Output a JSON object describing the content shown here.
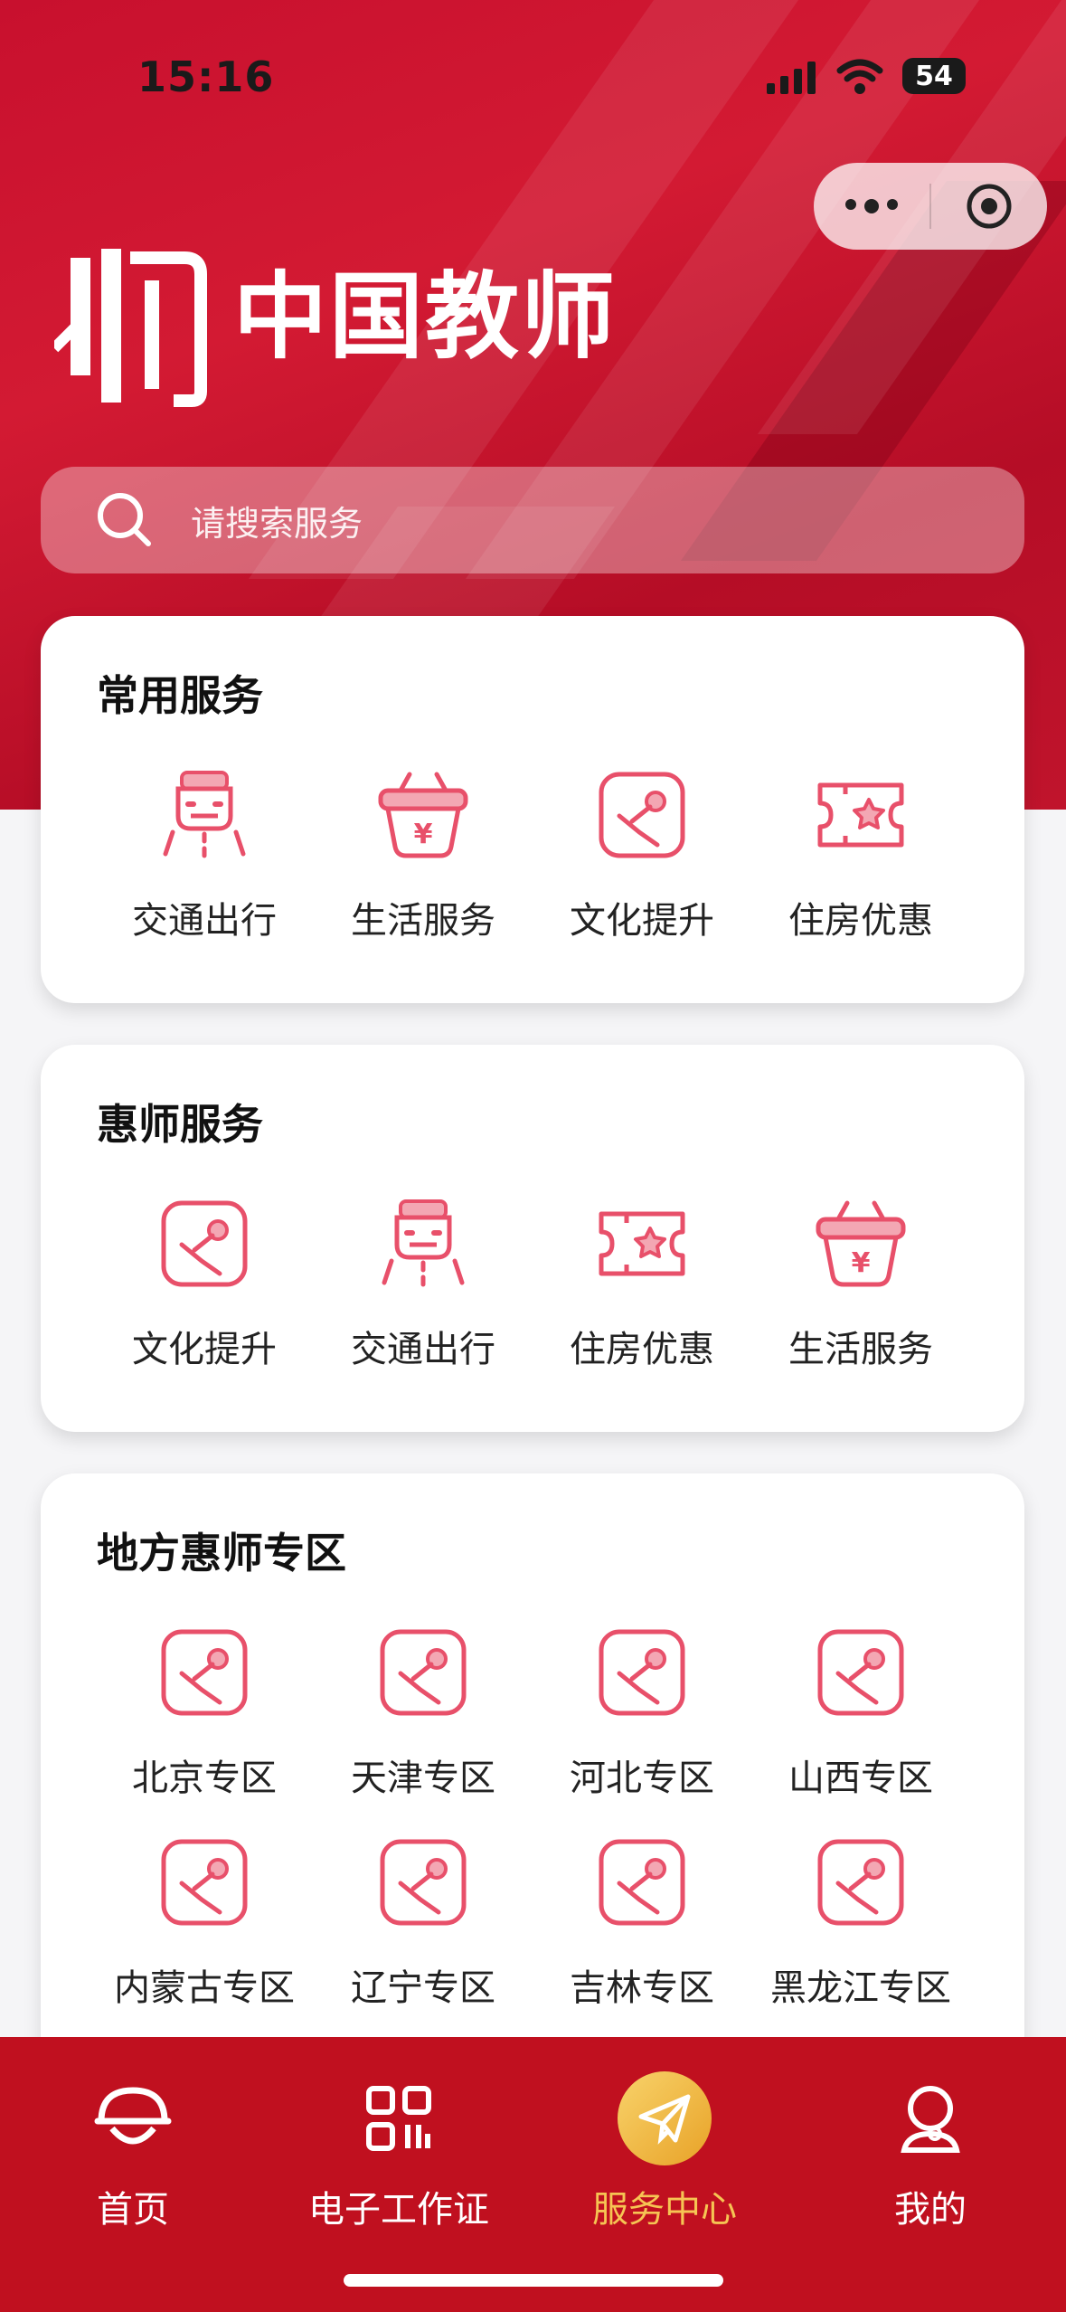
{
  "status_bar": {
    "time": "15:16",
    "battery": "54"
  },
  "app": {
    "brand": "中国教师"
  },
  "search": {
    "placeholder": "请搜索服务"
  },
  "sections": [
    {
      "title": "常用服务",
      "items": [
        {
          "label": "交通出行",
          "icon": "transport-icon"
        },
        {
          "label": "生活服务",
          "icon": "basket-icon"
        },
        {
          "label": "文化提升",
          "icon": "culture-icon"
        },
        {
          "label": "住房优惠",
          "icon": "ticket-icon"
        }
      ]
    },
    {
      "title": "惠师服务",
      "items": [
        {
          "label": "文化提升",
          "icon": "culture-icon"
        },
        {
          "label": "交通出行",
          "icon": "transport-icon"
        },
        {
          "label": "住房优惠",
          "icon": "ticket-icon"
        },
        {
          "label": "生活服务",
          "icon": "basket-icon"
        }
      ]
    },
    {
      "title": "地方惠师专区",
      "items": [
        {
          "label": "北京专区",
          "icon": "culture-icon"
        },
        {
          "label": "天津专区",
          "icon": "culture-icon"
        },
        {
          "label": "河北专区",
          "icon": "culture-icon"
        },
        {
          "label": "山西专区",
          "icon": "culture-icon"
        },
        {
          "label": "内蒙古专区",
          "icon": "culture-icon"
        },
        {
          "label": "辽宁专区",
          "icon": "culture-icon"
        },
        {
          "label": "吉林专区",
          "icon": "culture-icon"
        },
        {
          "label": "黑龙江专区",
          "icon": "culture-icon"
        }
      ]
    }
  ],
  "tabbar": [
    {
      "label": "首页",
      "icon": "home-icon"
    },
    {
      "label": "电子工作证",
      "icon": "qr-code-icon"
    },
    {
      "label": "服务中心",
      "icon": "paper-plane-icon",
      "active": true
    },
    {
      "label": "我的",
      "icon": "user-icon"
    }
  ],
  "colors": {
    "brand_red": "#c8102e",
    "icon_pink": "#e8506a",
    "active_gold": "#f6c453"
  }
}
